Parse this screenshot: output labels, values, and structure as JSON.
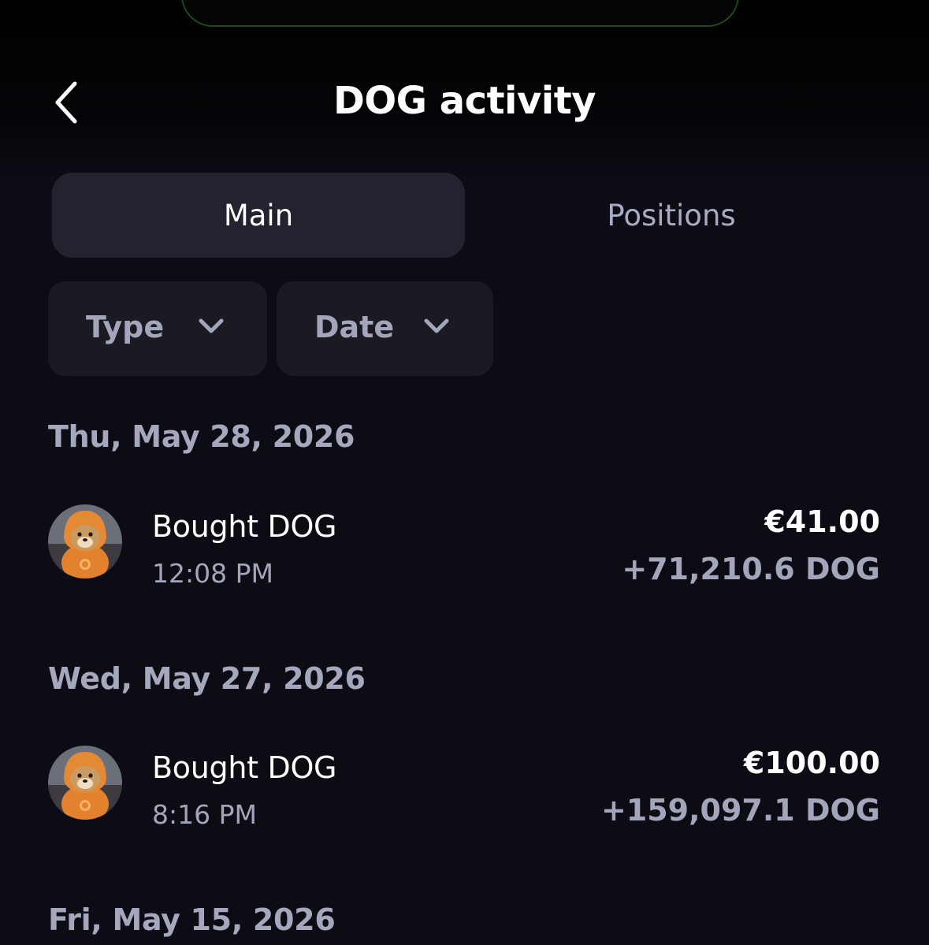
{
  "header": {
    "title": "DOG activity"
  },
  "tabs": {
    "main": "Main",
    "positions": "Positions"
  },
  "filters": {
    "type": "Type",
    "date": "Date"
  },
  "groups": [
    {
      "date": "Thu, May 28, 2026",
      "items": [
        {
          "title": "Bought DOG",
          "time": "12:08 PM",
          "amount": "€41.00",
          "quantity": "+71,210.6 DOG"
        }
      ]
    },
    {
      "date": "Wed, May 27, 2026",
      "items": [
        {
          "title": "Bought DOG",
          "time": "8:16 PM",
          "amount": "€100.00",
          "quantity": "+159,097.1 DOG"
        }
      ]
    },
    {
      "date": "Fri, May 15, 2026",
      "items": []
    }
  ],
  "colors": {
    "background": "#0d0c15",
    "active_tab": "#23222e",
    "filter_chip": "#1b1a22",
    "muted_text": "#a3a5bb",
    "top_card_border": "#1f4a1c"
  },
  "icons": {
    "back": "chevron-left-icon",
    "dropdown": "chevron-down-icon",
    "avatar": "dog-token-avatar"
  }
}
